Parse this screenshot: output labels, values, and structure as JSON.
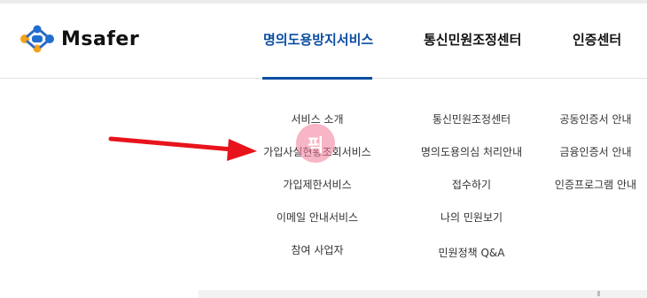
{
  "brand": {
    "name": "Msafer"
  },
  "gnb": {
    "items": [
      {
        "label": "명의도용방지서비스",
        "active": true
      },
      {
        "label": "통신민원조정센터",
        "active": false
      },
      {
        "label": "인증센터",
        "active": false
      }
    ]
  },
  "submenu": {
    "col1": [
      "서비스 소개",
      "가입사실현황조회서비스",
      "가입제한서비스",
      "이메일 안내서비스",
      "참여 사업자"
    ],
    "col2": [
      "통신민원조정센터",
      "명의도용의심 처리안내",
      "접수하기",
      "나의 민원보기",
      "민원정책 Q&A"
    ],
    "col3": [
      "공동인증서 안내",
      "금융인증서 안내",
      "인증프로그램 안내"
    ]
  },
  "annotations": {
    "arrow_color": "#e8131b",
    "watermark_text": "픽"
  },
  "colors": {
    "accent": "#0b4da2",
    "logo_orange": "#f5a11a",
    "logo_blue": "#1f6fd0"
  }
}
